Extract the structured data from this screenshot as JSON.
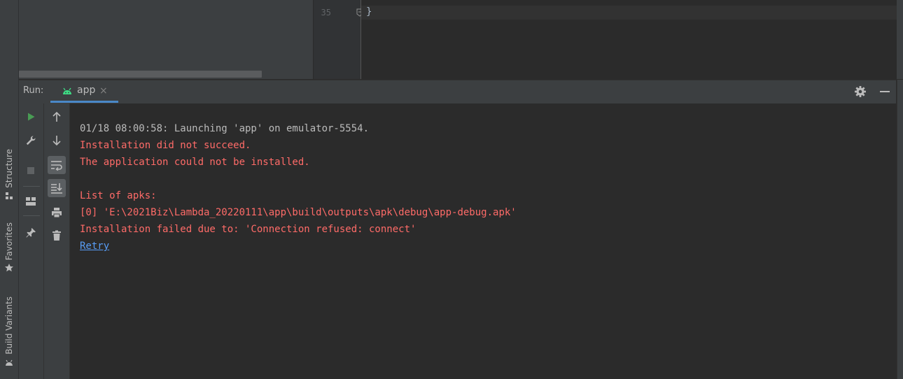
{
  "sidebar": {
    "structure_label": "Structure",
    "favorites_label": "Favorites",
    "build_variants_label": "Build Variants"
  },
  "editor": {
    "line_number": "35",
    "code_line": "}"
  },
  "run_panel": {
    "run_label": "Run:",
    "tab_label": "app",
    "close_glyph": "×"
  },
  "console": {
    "launch_line": "01/18 08:00:58: Launching 'app' on emulator-5554.",
    "error_lines": [
      "Installation did not succeed.",
      "The application could not be installed."
    ],
    "apk_header": "List of apks:",
    "apk_path": "[0] 'E:\\2021Biz\\Lambda_20220111\\app\\build\\outputs\\apk\\debug\\app-debug.apk'",
    "failure_reason": "Installation failed due to: 'Connection refused: connect'",
    "retry_link": "Retry"
  },
  "colors": {
    "error_text": "#ff6b68",
    "link_text": "#589df6",
    "run_green": "#499c54",
    "android_green": "#3ddc84",
    "tab_underline": "#4a88c7"
  }
}
